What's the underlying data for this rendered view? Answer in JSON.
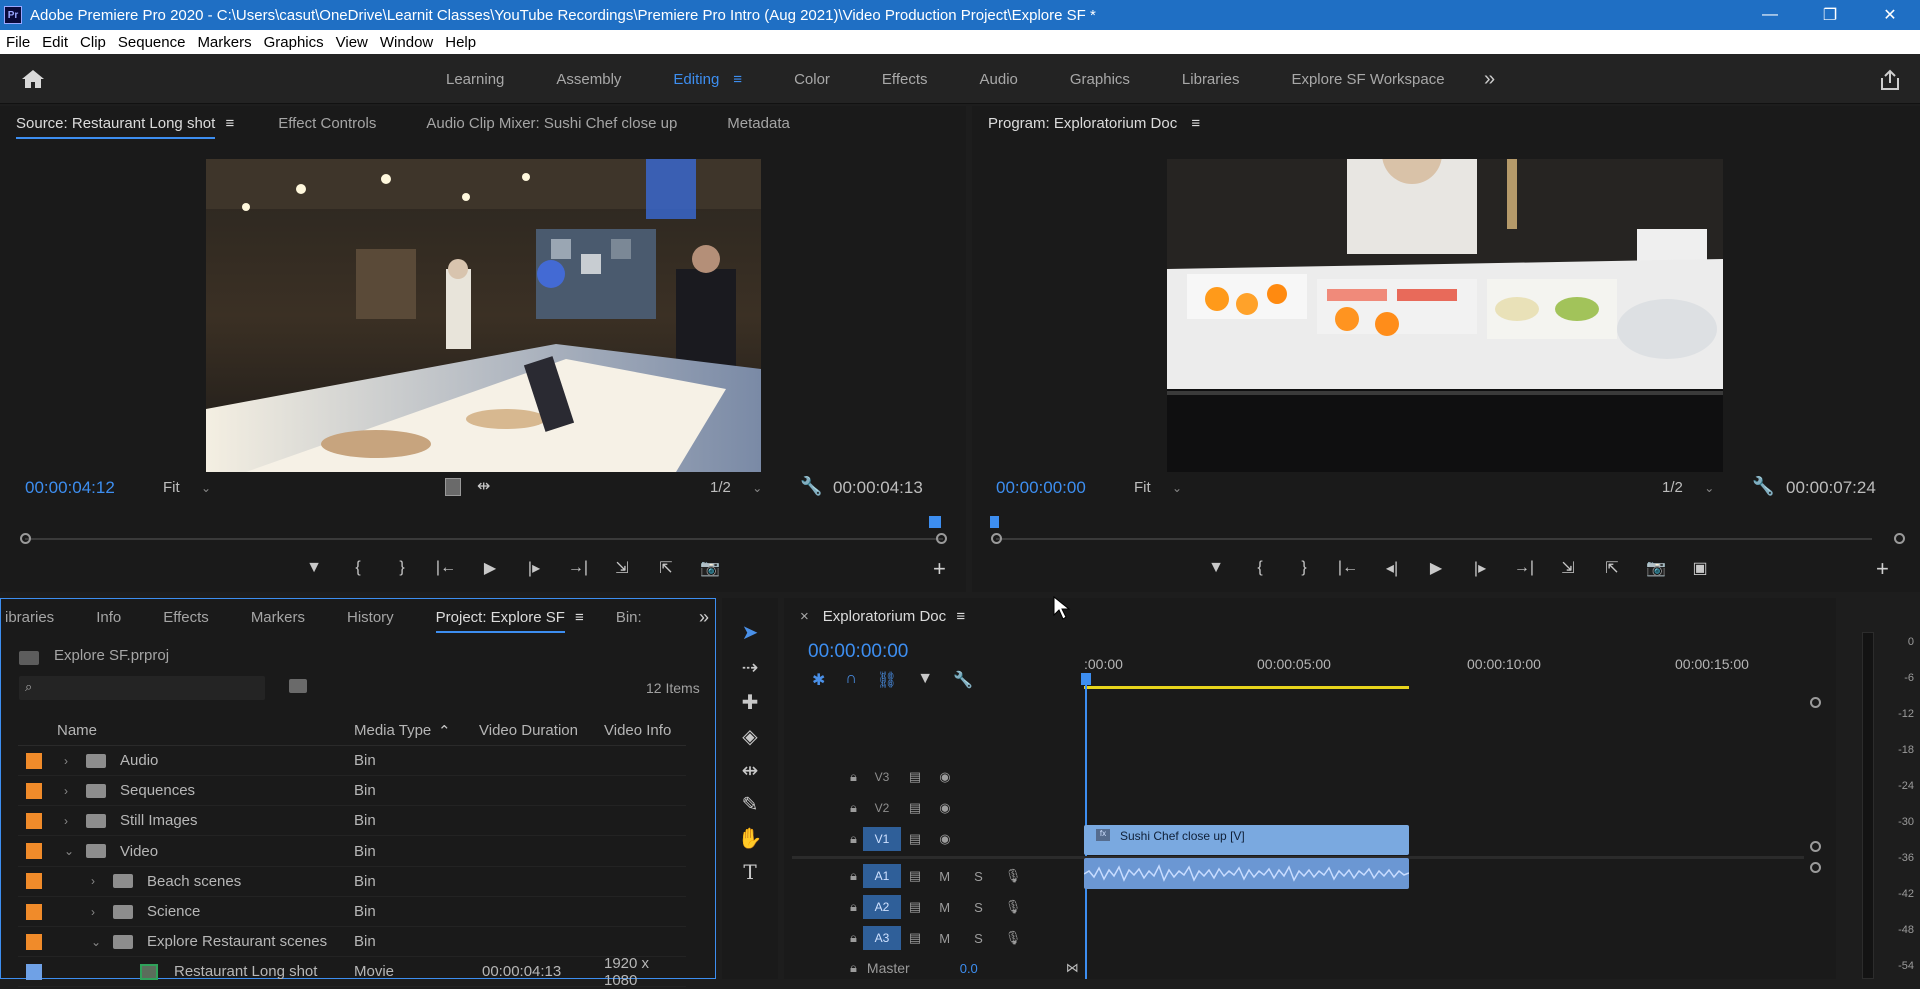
{
  "app": {
    "title": "Adobe Premiere Pro 2020 - C:\\Users\\casut\\OneDrive\\Learnit Classes\\YouTube Recordings\\Premiere Pro Intro (Aug 2021)\\Video Production Project\\Explore SF *",
    "logo": "Pr"
  },
  "window_controls": [
    "—",
    "❐",
    "✕"
  ],
  "menu": [
    "File",
    "Edit",
    "Clip",
    "Sequence",
    "Markers",
    "Graphics",
    "View",
    "Window",
    "Help"
  ],
  "workspaces": {
    "tabs": [
      "Learning",
      "Assembly",
      "Editing",
      "Color",
      "Effects",
      "Audio",
      "Graphics",
      "Libraries",
      "Explore SF Workspace"
    ],
    "active": "Editing",
    "more": "»",
    "menu_glyph": "≡"
  },
  "source_monitor": {
    "tabs": [
      "Source: Restaurant Long shot",
      "Effect Controls",
      "Audio Clip Mixer: Sushi Chef close up",
      "Metadata"
    ],
    "tab_menu_glyph": "≡",
    "timecode_in": "00:00:04:12",
    "fit": "Fit",
    "resolution": "1/2",
    "timecode_duration": "00:00:04:13",
    "controls": [
      "▼",
      "{",
      "}",
      "|←",
      "▶",
      "|▸",
      "→|",
      "⇲",
      "⇱",
      "📷"
    ],
    "add": "+"
  },
  "program_monitor": {
    "title": "Program: Exploratorium Doc",
    "tab_menu_glyph": "≡",
    "timecode_in": "00:00:00:00",
    "fit": "Fit",
    "resolution": "1/2",
    "timecode_duration": "00:00:07:24",
    "controls": [
      "▼",
      "{",
      "}",
      "|←",
      "◂|",
      "▶",
      "|▸",
      "→|",
      "⇲",
      "⇱",
      "📷",
      "▣"
    ],
    "add": "+"
  },
  "project_panel": {
    "tabs": [
      "ibraries",
      "Info",
      "Effects",
      "Markers",
      "History",
      "Project: Explore SF",
      "Bin:"
    ],
    "active_tab": "Project: Explore SF",
    "tab_menu_glyph": "≡",
    "overflow_glyph": "»",
    "project_file": "Explore SF.prproj",
    "item_count": "12 Items",
    "search_placeholder": "",
    "columns": [
      "Name",
      "Media Type",
      "Video Duration",
      "Video Info"
    ],
    "sort_glyph": "^",
    "rows": [
      {
        "name": "Audio",
        "type": "Bin",
        "duration": "",
        "info": "",
        "indent": 0,
        "expanded": false,
        "color": "#f08b2a",
        "kind": "folder"
      },
      {
        "name": "Sequences",
        "type": "Bin",
        "duration": "",
        "info": "",
        "indent": 0,
        "expanded": false,
        "color": "#f08b2a",
        "kind": "folder"
      },
      {
        "name": "Still Images",
        "type": "Bin",
        "duration": "",
        "info": "",
        "indent": 0,
        "expanded": false,
        "color": "#f08b2a",
        "kind": "folder"
      },
      {
        "name": "Video",
        "type": "Bin",
        "duration": "",
        "info": "",
        "indent": 0,
        "expanded": true,
        "color": "#f08b2a",
        "kind": "folder"
      },
      {
        "name": "Beach scenes",
        "type": "Bin",
        "duration": "",
        "info": "",
        "indent": 1,
        "expanded": false,
        "color": "#f08b2a",
        "kind": "folder"
      },
      {
        "name": "Science",
        "type": "Bin",
        "duration": "",
        "info": "",
        "indent": 1,
        "expanded": false,
        "color": "#f08b2a",
        "kind": "folder"
      },
      {
        "name": "Explore Restaurant scenes",
        "type": "Bin",
        "duration": "",
        "info": "",
        "indent": 1,
        "expanded": true,
        "color": "#f08b2a",
        "kind": "folder"
      },
      {
        "name": "Restaurant Long shot",
        "type": "Movie",
        "duration": "00:00:04:13",
        "info": "1920 x 1080",
        "indent": 2,
        "expanded": false,
        "color": "#6fa1e6",
        "kind": "clip"
      }
    ]
  },
  "tools": [
    "selection-tool",
    "track-select-tool",
    "ripple-edit-tool",
    "razor-tool",
    "slip-tool",
    "pen-tool",
    "hand-tool",
    "type-tool"
  ],
  "timeline": {
    "tab_close": "×",
    "sequence_name": "Exploratorium Doc",
    "tab_menu_glyph": "≡",
    "timecode": "00:00:00:00",
    "ruler": [
      ":00:00",
      "00:00:05:00",
      "00:00:10:00",
      "00:00:15:00"
    ],
    "video_tracks": [
      "V3",
      "V2",
      "V1"
    ],
    "audio_tracks": [
      "A1",
      "A2",
      "A3"
    ],
    "track_buttons": {
      "mute": "M",
      "solo": "S"
    },
    "master_label": "Master",
    "master_value": "0.0",
    "clip_video_label": "Sushi Chef close up [V]",
    "clip_fx_label": "fx"
  },
  "audio_meter": {
    "scale": [
      "0",
      "-6",
      "-12",
      "-18",
      "-24",
      "-30",
      "-36",
      "-42",
      "-48",
      "-54"
    ]
  }
}
